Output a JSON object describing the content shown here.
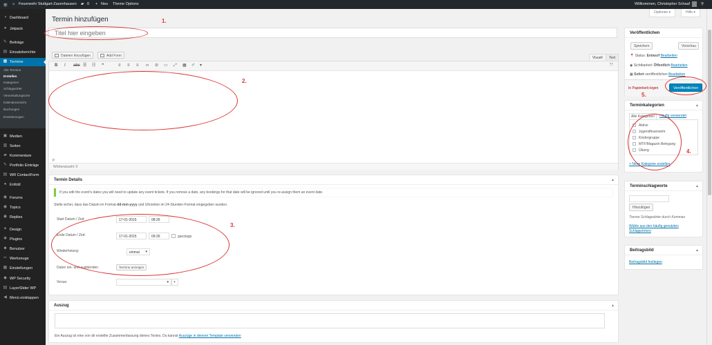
{
  "admin_bar": {
    "site_name": "Feuerwehr Stuttgart-Zazenhausen",
    "comments_count": "0",
    "new_label": "Neu",
    "theme_options": "Theme Options",
    "greeting": "Willkommen, Christopher Schaaf"
  },
  "sidebar": {
    "items": [
      {
        "label": "Dashboard",
        "icon": "dashboard-icon",
        "glyph": "◑"
      },
      {
        "label": "Jetpack",
        "icon": "jetpack-icon",
        "glyph": "●"
      },
      {
        "label": "Beiträge",
        "icon": "pin-icon",
        "glyph": "✎"
      },
      {
        "label": "Einsatzberichte",
        "icon": "document-icon",
        "glyph": "▤"
      },
      {
        "label": "Termine",
        "icon": "calendar-icon",
        "glyph": "▦"
      },
      {
        "label": "Medien",
        "icon": "media-icon",
        "glyph": "▣"
      },
      {
        "label": "Seiten",
        "icon": "pages-icon",
        "glyph": "▥"
      },
      {
        "label": "Kommentare",
        "icon": "comments-icon",
        "glyph": "▰"
      },
      {
        "label": "Portfolio Einträge",
        "icon": "portfolio-icon",
        "glyph": "✎"
      },
      {
        "label": "WR ContactForm",
        "icon": "contact-form-icon",
        "glyph": "▤"
      },
      {
        "label": "Enfold",
        "icon": "enfold-icon",
        "glyph": "●"
      },
      {
        "label": "Forums",
        "icon": "forums-icon",
        "glyph": "◉"
      },
      {
        "label": "Topics",
        "icon": "topics-icon",
        "glyph": "◉"
      },
      {
        "label": "Replies",
        "icon": "replies-icon",
        "glyph": "◉"
      },
      {
        "label": "Design",
        "icon": "design-icon",
        "glyph": "✦"
      },
      {
        "label": "Plugins",
        "icon": "plugins-icon",
        "glyph": "✚"
      },
      {
        "label": "Benutzer",
        "icon": "users-icon",
        "glyph": "☻"
      },
      {
        "label": "Werkzeuge",
        "icon": "tools-icon",
        "glyph": "✂"
      },
      {
        "label": "Einstellungen",
        "icon": "settings-icon",
        "glyph": "▦"
      },
      {
        "label": "WP Security",
        "icon": "shield-icon",
        "glyph": "◆"
      },
      {
        "label": "LayerSlider WP",
        "icon": "layerslider-icon",
        "glyph": "▤"
      },
      {
        "label": "Menü einklappen",
        "icon": "collapse-icon",
        "glyph": "◀"
      }
    ],
    "submenu": [
      "Alle Termine",
      "Erstellen",
      "Kategorien",
      "Schlagwörter",
      "Veranstaltungsorte",
      "Kalenderansicht",
      "Buchungen",
      "Erweiterungen"
    ]
  },
  "screen_options": {
    "options": "Optionen ▾",
    "help": "Hilfe ▾"
  },
  "page": {
    "title": "Termin hinzufügen",
    "title_placeholder": "Titel hier eingeben"
  },
  "editor": {
    "add_media": "Dateien hinzufügen",
    "add_form": "Add Form",
    "tab_visual": "Visuell",
    "tab_text": "Text",
    "path": "p",
    "wordcount": "Wörteranzahl: 0"
  },
  "event_details": {
    "title": "Termin Details",
    "notice": "If you edit the event's dates you will need to update any event tickets. If you remove a date, any bookings for that date will be ignored until you re-assign them an event date.",
    "format_hint_pre": "Stelle sicher, dass das Datum im Format ",
    "format_bold": "dd-mm-yyyy",
    "format_hint_post": " und Uhrzeiten im 24-Stunden-Format eingegeben wurden.",
    "start_label": "Start Datum / Zeit:",
    "start_date": "17-01-2015",
    "start_time": "08:26",
    "end_label": "Ende Datum / Zeit:",
    "end_date": "17-01-2015",
    "end_time": "09:26",
    "all_day": "ganztags",
    "repeat_label": "Wiederholung:",
    "repeat_value": "einmal",
    "show_dates_label": "Daten ein- und ausblenden",
    "show_dates_button": "Termine anzeigen",
    "venue_label": "Venue:"
  },
  "excerpt": {
    "title": "Auszug",
    "hint": "Ein Auszug ist eine von dir erstellte Zusammenfassung deines Textes. Du kannst ",
    "link": "Auszüge in deinem Template verwenden"
  },
  "publish": {
    "title": "Veröffentlichen",
    "save": "Speichern",
    "preview": "Vorschau",
    "status_label": "Status: ",
    "status_value": "Entwurf",
    "visibility_label": "Sichtbarkeit: ",
    "visibility_value": "Öffentlich",
    "schedule": "Sofort",
    "schedule_post": " veröffentlichen",
    "edit": "Bearbeiten",
    "trash": "In Papierkorb legen",
    "publish_button": "Veröffentlichen"
  },
  "categories": {
    "title": "Terminkategorien",
    "tab_all": "Alle Kategorien",
    "tab_popular": "Häufig verwendet",
    "items": [
      "Aktive",
      "Jugendfeuerwehr",
      "Kindergruppe",
      "MTF/Magazin Belegung",
      "Übung"
    ],
    "add_link": "+ Neue Kategorie erstellen"
  },
  "tags": {
    "title": "Terminschlagworte",
    "add_button": "Hinzufügen",
    "hint": "Trenne Schlagwörter durch Kommas",
    "choose_link": "Wähle aus den häufig genutzten Schlagwörtern"
  },
  "featured_image": {
    "title": "Beitragsbild",
    "link": "Beitragsbild festlegen"
  },
  "annotations": [
    "1.",
    "2.",
    "3.",
    "4.",
    "5."
  ],
  "colors": {
    "annotation_red": "#dd3333",
    "accent_blue": "#0073aa",
    "publish_blue": "#0085ba"
  }
}
